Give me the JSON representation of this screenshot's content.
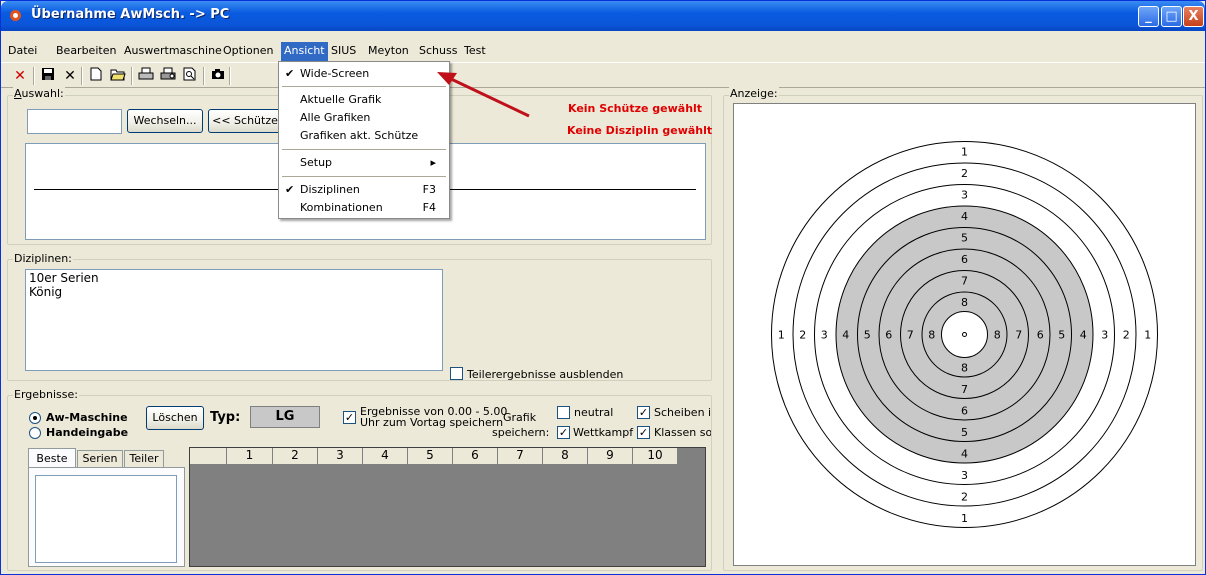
{
  "window": {
    "title": "Übernahme AwMsch. -> PC"
  },
  "menu": [
    "Datei",
    "Bearbeiten",
    "Auswertmaschine",
    "Optionen",
    "Ansicht",
    "SIUS",
    "Meyton",
    "Schuss",
    "Test"
  ],
  "dropdown": {
    "items": [
      {
        "label": "Wide-Screen",
        "checked": true,
        "shortcut": ""
      },
      {
        "label": "Aktuelle Grafik",
        "checked": false,
        "shortcut": ""
      },
      {
        "label": "Alle Grafiken",
        "checked": false,
        "shortcut": ""
      },
      {
        "label": "Grafiken akt. Schütze",
        "checked": false,
        "shortcut": ""
      },
      {
        "label": "Setup",
        "checked": false,
        "shortcut": "▸"
      },
      {
        "label": "Disziplinen",
        "checked": true,
        "shortcut": "F3"
      },
      {
        "label": "Kombinationen",
        "checked": false,
        "shortcut": "F4"
      }
    ],
    "check_mark": "✔"
  },
  "auswahl": {
    "label": "Auswahl:",
    "wechseln_button": "Wechseln...",
    "schuetze_button": "<< Schütze",
    "warn1": "Kein Schütze gewählt",
    "warn2": "Keine Disziplin gewählt"
  },
  "disziplinen": {
    "label": "Diziplinen:",
    "items": [
      "10er Serien",
      "König"
    ],
    "checkbox_label": "Teilerergebnisse ausblenden"
  },
  "ergebnisse": {
    "label": "Ergebnisse:",
    "radio1": "Aw-Maschine",
    "radio2": "Handeingabe",
    "loeschen_button": "Löschen",
    "typ_label": "Typ:",
    "typ_value": "LG",
    "erg_check1": "Ergebnisse von 0.00 - 5.00",
    "erg_check2": "Uhr zum Vortag speichern",
    "grafik_label1": "Grafik",
    "grafik_label2": "speichern:",
    "neutral": "neutral",
    "wettkampf": "Wettkampf",
    "scheiben": "Scheiben in",
    "klassen": "Klassen sofc",
    "tabs": [
      "Beste",
      "Serien",
      "Teiler"
    ],
    "columns": [
      "1",
      "2",
      "3",
      "4",
      "5",
      "6",
      "7",
      "8",
      "9",
      "10"
    ]
  },
  "anzeige": {
    "label": "Anzeige:",
    "ring_labels": [
      "1",
      "2",
      "3",
      "4",
      "5",
      "6",
      "7",
      "8"
    ]
  },
  "colors": {
    "warning": "#e00000",
    "target_fill": "#c8c8c8",
    "titlebar": "#0a5be0",
    "menu_highlight": "#316ac5"
  },
  "icons": [
    "close-x-red-icon",
    "save-icon",
    "delete-icon",
    "new-doc-icon",
    "open-folder-icon",
    "print-icon",
    "print-setup-icon",
    "print-preview-icon",
    "camera-icon"
  ]
}
